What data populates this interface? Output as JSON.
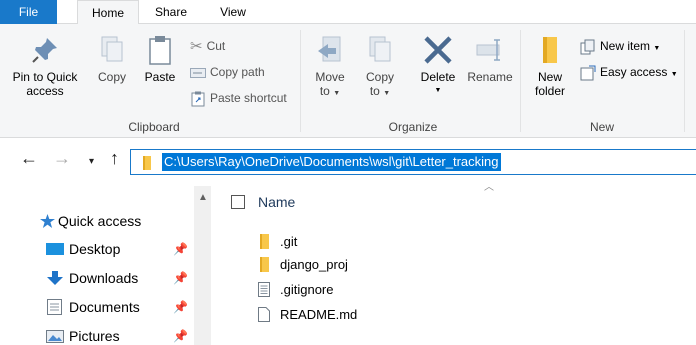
{
  "tabs": [
    {
      "label": "File"
    },
    {
      "label": "Home"
    },
    {
      "label": "Share"
    },
    {
      "label": "View"
    }
  ],
  "ribbon": {
    "clipboard": {
      "label": "Clipboard",
      "pin_to_quick_access": "Pin to Quick\naccess",
      "pin_line1": "Pin to Quick",
      "pin_line2": "access",
      "copy": "Copy",
      "paste": "Paste",
      "cut": "Cut",
      "copy_path": "Copy path",
      "paste_shortcut": "Paste shortcut"
    },
    "organize": {
      "label": "Organize",
      "move_to_line1": "Move",
      "move_to_line2": "to",
      "copy_to_line1": "Copy",
      "copy_to_line2": "to",
      "delete": "Delete",
      "rename": "Rename"
    },
    "new": {
      "label": "New",
      "new_folder_line1": "New",
      "new_folder_line2": "folder",
      "new_item": "New item",
      "easy_access": "Easy access"
    }
  },
  "address": {
    "path": "C:\\Users\\Ray\\OneDrive\\Documents\\wsl\\git\\Letter_tracking"
  },
  "navpane": {
    "items": [
      {
        "label": "Quick access",
        "icon": "star-icon"
      },
      {
        "label": "Desktop",
        "icon": "desktop-icon",
        "pinned": true
      },
      {
        "label": "Downloads",
        "icon": "download-icon",
        "pinned": true
      },
      {
        "label": "Documents",
        "icon": "documents-icon",
        "pinned": true
      },
      {
        "label": "Pictures",
        "icon": "pictures-icon",
        "pinned": true
      }
    ]
  },
  "filelist": {
    "column_name": "Name",
    "files": [
      {
        "name": ".git",
        "type": "folder"
      },
      {
        "name": "django_proj",
        "type": "folder"
      },
      {
        "name": ".gitignore",
        "type": "text-file"
      },
      {
        "name": "README.md",
        "type": "file"
      }
    ]
  },
  "colors": {
    "accent": "#1979ca",
    "selection": "#0078d7",
    "folder": "#f8c74a"
  }
}
